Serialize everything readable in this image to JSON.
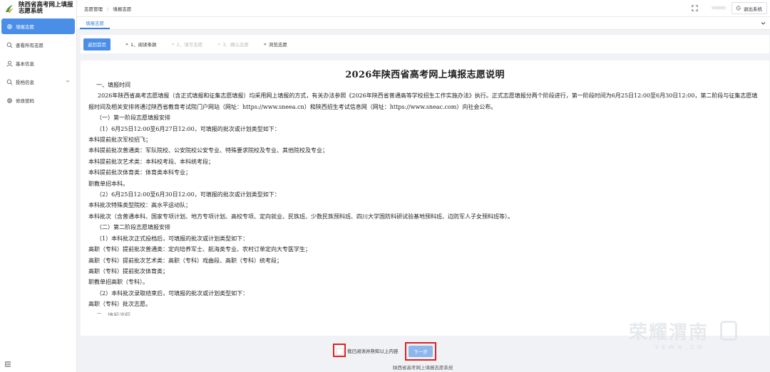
{
  "app": {
    "title": "陕西省高考网上填报志愿系统"
  },
  "sidebar": {
    "items": [
      {
        "label": "填报志愿",
        "icon": "gear-icon",
        "active": true
      },
      {
        "label": "查看所有志愿",
        "icon": "search-icon",
        "active": false
      },
      {
        "label": "基本信息",
        "icon": "user-icon",
        "active": false
      },
      {
        "label": "投档信息",
        "icon": "search-icon",
        "active": false,
        "has_caret": true
      },
      {
        "label": "修改密码",
        "icon": "gear-icon",
        "active": false
      }
    ]
  },
  "header": {
    "breadcrumb": [
      "志愿管理",
      "填报志愿"
    ],
    "user_name": "******",
    "logout_label": "退出系统"
  },
  "tabs": [
    {
      "label": "填报志愿"
    }
  ],
  "steps": {
    "back_label": "返回首页",
    "items": [
      {
        "label": "1、阅读条款",
        "state": "done"
      },
      {
        "label": "2、填写志愿",
        "state": "pending"
      },
      {
        "label": "3、确认志愿",
        "state": "pending"
      },
      {
        "label": "浏览志愿",
        "state": "done"
      }
    ]
  },
  "document": {
    "title": "2026年陕西省高考网上填报志愿说明",
    "lines": [
      {
        "style": "indent1",
        "text": "一、填报时间"
      },
      {
        "style": "para",
        "text": "2026年陕西省高考志愿填报（含正式填报和征集志愿填报）均采用网上填报的方式，有关办法参照《2026年陕西省普通高等学校招生工作实施办法》执行。正式志愿填报分两个阶段进行，第一阶段时间为6月25日12:00至6月30日12:00，第二阶段与征集志愿填报时间及相关安排将通过陕西省教育考试院门户网站（网址：https://www.sneea.cn）和陕西招生考试信息网（网址：https://www.sneac.com）向社会公布。"
      },
      {
        "style": "indent1",
        "text": "（一）第一阶段志愿填报安排"
      },
      {
        "style": "indent1",
        "text": "（1）6月25日12:00至6月27日12:00，可填报的批次或计划类型如下："
      },
      {
        "style": "plain",
        "text": "本科提前批次军校招飞；"
      },
      {
        "style": "plain",
        "text": "本科提前批次普通类：军队院校、公安院校公安专业、特殊要求院校及专业、其他院校及专业；"
      },
      {
        "style": "plain",
        "text": "本科提前批次艺术类：本科校考段、本科统考段；"
      },
      {
        "style": "plain",
        "text": "本科提前批次体育类：体育类本科专业；"
      },
      {
        "style": "plain",
        "text": "职教单招本科。"
      },
      {
        "style": "indent1",
        "text": "（2）6月25日12:00至6月30日12:00，可填报的批次或计划类型如下："
      },
      {
        "style": "plain",
        "text": "本科批次特殊类型院校：高水平运动队；"
      },
      {
        "style": "plain",
        "text": "本科批次（含普通本科、国家专项计划、地方专项计划、高校专项、定向就业、民族班、少数民族预科班、四川大学国防科研试验基地预科班、边防军人子女预科班等）。"
      },
      {
        "style": "indent1",
        "text": "（二）第二阶段志愿填报安排"
      },
      {
        "style": "indent1",
        "text": "（1）本科批次正式投档后，可填报的批次或计划类型如下："
      },
      {
        "style": "plain",
        "text": "高职（专科）提前批次普通类：定向培养军士、航海类专业、农村订单定向大专医学生；"
      },
      {
        "style": "plain",
        "text": "高职（专科）提前批次艺术类：高职（专科）戏曲段、高职（专科）统考段；"
      },
      {
        "style": "plain",
        "text": "高职（专科）提前批次体育类；"
      },
      {
        "style": "plain",
        "text": "职教单招高职（专科）。"
      },
      {
        "style": "indent1",
        "text": "（2）本科批次录取结束后，可填报的批次或计划类型如下："
      },
      {
        "style": "plain",
        "text": "高职（专科）批次志愿。"
      }
    ],
    "cut_line": "二、填报流程"
  },
  "footer": {
    "agree_label": "我已阅读并熟知以上内容",
    "next_label": "下一步",
    "system_name": "陕西省高考网上填报志愿系统"
  },
  "watermark": {
    "text": "荣耀渭南",
    "url": "YEWN.CN"
  },
  "colors": {
    "primary": "#4a8ee8",
    "highlight_border": "#e02020",
    "disabled_button": "#8db6ec"
  }
}
